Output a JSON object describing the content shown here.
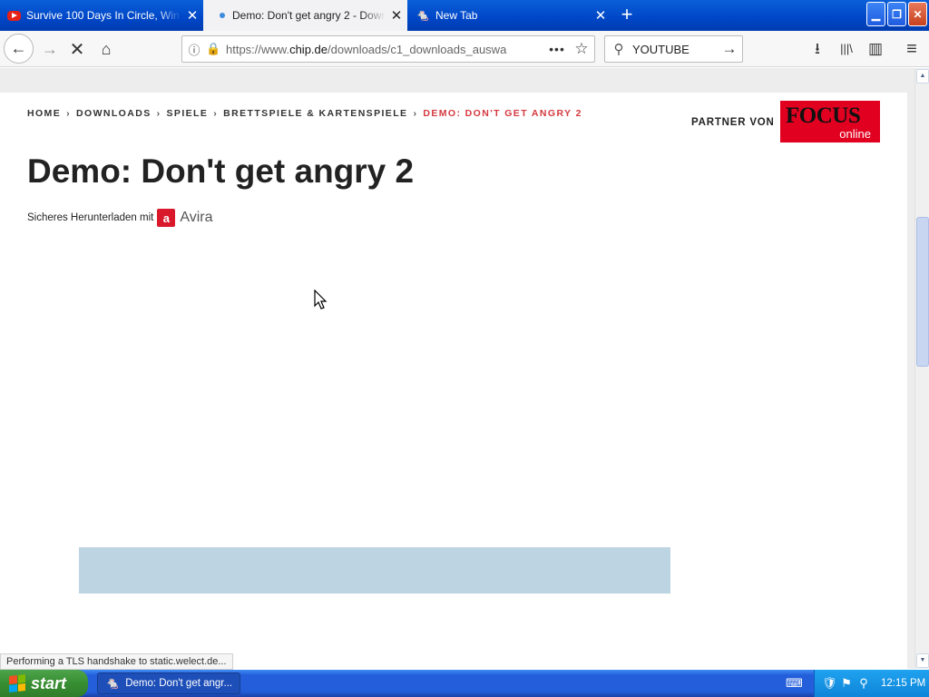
{
  "tabs": [
    {
      "label": "Survive 100 Days In Circle, Win $",
      "icon": "youtube-icon",
      "close": "✕"
    },
    {
      "label": "Demo: Don't get angry 2 - Downlo",
      "icon": "loading-dot-icon",
      "close": "✕"
    },
    {
      "label": "New Tab",
      "icon": "mouse-icon",
      "close": "✕"
    }
  ],
  "window_controls": {
    "minimize": "▁",
    "maximize": "❐",
    "close": "✕"
  },
  "new_tab_symbol": "+",
  "nav": {
    "back": "←",
    "forward": "→",
    "stop": "✕",
    "home": "⌂",
    "url_prefix": "https://www.",
    "url_host": "chip.de",
    "url_path": "/downloads/c1_downloads_auswa",
    "page_actions": "•••",
    "bookmark": "☆",
    "search_value": "YOUTUBE",
    "search_go": "→",
    "download": "⭳",
    "library": "|||\\",
    "sidebar": "▥",
    "menu": "≡"
  },
  "page": {
    "breadcrumbs": [
      "HOME",
      "DOWNLOADS",
      "SPIELE",
      "BRETTSPIELE & KARTENSPIELE"
    ],
    "breadcrumb_current": "DEMO: DON'T GET ANGRY 2",
    "breadcrumb_separator": "›",
    "partner_label": "PARTNER VON",
    "partner_logo": {
      "main": "FOCUS",
      "sub": "online",
      "color": "#e1001f"
    },
    "title": "Demo: Don't get angry 2",
    "safe_download_text": "Sicheres Herunterladen mit",
    "avira_mark": "a",
    "avira_name": "Avira"
  },
  "status_text": "Performing a TLS handshake to static.welect.de...",
  "taskbar": {
    "start_label": "start",
    "task_label": "Demo: Don't get angr...",
    "clock": "12:15 PM"
  },
  "colors": {
    "breadcrumb_current": "#d4393f",
    "ad_bar": "#bdd4e3",
    "tab_bar": "#0046c7"
  }
}
